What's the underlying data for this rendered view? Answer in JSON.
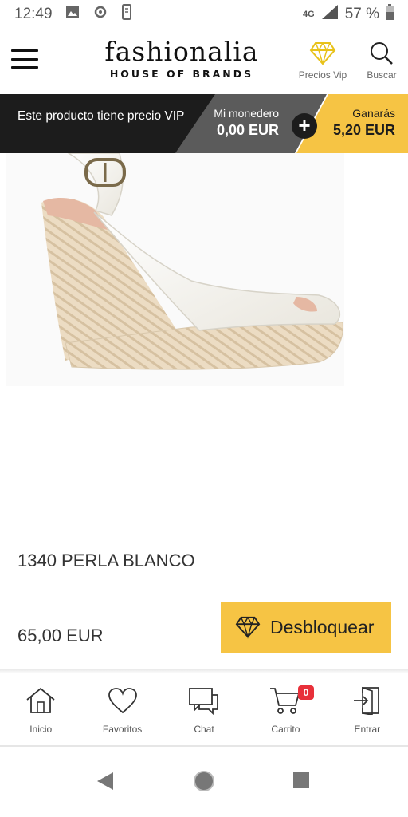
{
  "status_bar": {
    "time": "12:49",
    "network": "4G",
    "battery": "57 %",
    "icons": [
      "image-icon",
      "cast-icon",
      "phone-icon",
      "signal-icon",
      "battery-icon"
    ]
  },
  "header": {
    "brand": "fashionalia",
    "tagline": "HOUSE OF BRANDS",
    "vip_label": "Precios Vip",
    "search_label": "Buscar"
  },
  "vip_banner": {
    "message": "Este producto tiene precio VIP",
    "wallet_label": "Mi monedero",
    "wallet_value": "0,00 EUR",
    "plus": "+",
    "earn_label": "Ganarás",
    "earn_value": "5,20 EUR"
  },
  "product": {
    "name": "1340 PERLA BLANCO",
    "price": "65,00 EUR",
    "unlock_label": "Desbloquear"
  },
  "bottom_nav": {
    "items": [
      {
        "label": "Inicio",
        "icon": "home-icon"
      },
      {
        "label": "Favoritos",
        "icon": "heart-icon"
      },
      {
        "label": "Chat",
        "icon": "chat-icon"
      },
      {
        "label": "Carrito",
        "icon": "cart-icon"
      },
      {
        "label": "Entrar",
        "icon": "login-icon"
      }
    ],
    "cart_badge": "0"
  },
  "colors": {
    "accent_yellow": "#f6c444",
    "banner_black": "#1c1c1c",
    "banner_gray": "#5b5b5b",
    "badge_red": "#e8303a"
  }
}
